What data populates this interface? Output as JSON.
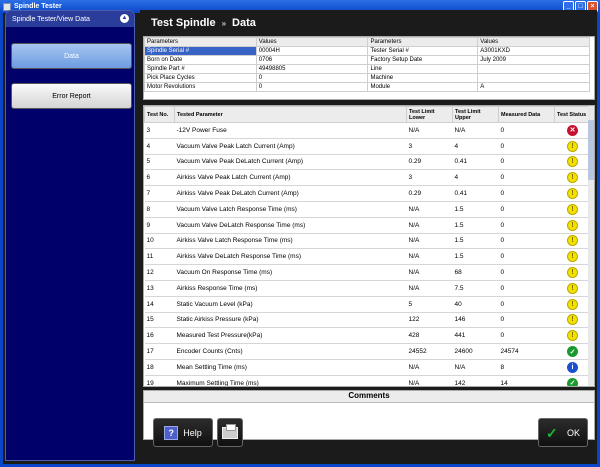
{
  "window": {
    "title": "Spindle Tester"
  },
  "sidebar": {
    "title": "Spindle Tester/View Data",
    "buttons": [
      {
        "label": "Data"
      },
      {
        "label": "Error Report"
      }
    ]
  },
  "header": {
    "crumb1": "Test Spindle",
    "separator": "»",
    "crumb2": "Data"
  },
  "params": {
    "headers": [
      "Parameters",
      "Values",
      "Parameters",
      "Values"
    ],
    "rows": [
      [
        "Spindle Serial #",
        "00004H",
        "Tester Serial #",
        "A3001KXD"
      ],
      [
        "Born on Date",
        "0706",
        "Factory Setup Date",
        "July 2009"
      ],
      [
        "Spindle Part #",
        "49498805",
        "Line",
        ""
      ],
      [
        "Pick Place Cycles",
        "0",
        "Machine",
        ""
      ],
      [
        "Motor Revolutions",
        "0",
        "Module",
        "A"
      ]
    ]
  },
  "tests": {
    "headers": [
      "Test No.",
      "Tested Parameter",
      "Test Limit Lower",
      "Test Limit Upper",
      "Measured Data",
      "Test Status"
    ],
    "rows": [
      {
        "no": "3",
        "param": "-12V Power Fuse",
        "lower": "N/A",
        "upper": "N/A",
        "measured": "0",
        "status": "fail"
      },
      {
        "no": "4",
        "param": "Vacuum Valve Peak Latch Current (Amp)",
        "lower": "3",
        "upper": "4",
        "measured": "0",
        "status": "warn"
      },
      {
        "no": "5",
        "param": "Vacuum Valve Peak DeLatch Current (Amp)",
        "lower": "0.29",
        "upper": "0.41",
        "measured": "0",
        "status": "warn"
      },
      {
        "no": "6",
        "param": "Airkiss Valve Peak Latch Current (Amp)",
        "lower": "3",
        "upper": "4",
        "measured": "0",
        "status": "warn"
      },
      {
        "no": "7",
        "param": "Airkiss Valve Peak DeLatch Current (Amp)",
        "lower": "0.29",
        "upper": "0.41",
        "measured": "0",
        "status": "warn"
      },
      {
        "no": "8",
        "param": "Vacuum Valve Latch Response Time (ms)",
        "lower": "N/A",
        "upper": "1.5",
        "measured": "0",
        "status": "warn"
      },
      {
        "no": "9",
        "param": "Vacuum Valve DeLatch Response Time (ms)",
        "lower": "N/A",
        "upper": "1.5",
        "measured": "0",
        "status": "warn"
      },
      {
        "no": "10",
        "param": "Airkiss Valve Latch Response Time (ms)",
        "lower": "N/A",
        "upper": "1.5",
        "measured": "0",
        "status": "warn"
      },
      {
        "no": "11",
        "param": "Airkiss Valve DeLatch Response Time (ms)",
        "lower": "N/A",
        "upper": "1.5",
        "measured": "0",
        "status": "warn"
      },
      {
        "no": "12",
        "param": "Vacuum On Response Time (ms)",
        "lower": "N/A",
        "upper": "68",
        "measured": "0",
        "status": "warn"
      },
      {
        "no": "13",
        "param": "Airkiss Response Time (ms)",
        "lower": "N/A",
        "upper": "7.5",
        "measured": "0",
        "status": "warn"
      },
      {
        "no": "14",
        "param": "Static Vacuum Level (kPa)",
        "lower": "5",
        "upper": "40",
        "measured": "0",
        "status": "warn"
      },
      {
        "no": "15",
        "param": "Static Airkiss Pressure (kPa)",
        "lower": "122",
        "upper": "146",
        "measured": "0",
        "status": "warn"
      },
      {
        "no": "16",
        "param": "Measured Test Pressure(kPa)",
        "lower": "428",
        "upper": "441",
        "measured": "0",
        "status": "warn"
      },
      {
        "no": "17",
        "param": "Encoder Counts (Cnts)",
        "lower": "24552",
        "upper": "24600",
        "measured": "24574",
        "status": "pass"
      },
      {
        "no": "18",
        "param": "Mean Settling Time (ms)",
        "lower": "N/A",
        "upper": "N/A",
        "measured": "8",
        "status": "info"
      },
      {
        "no": "19",
        "param": "Maximum Settling Time (ms)",
        "lower": "N/A",
        "upper": "142",
        "measured": "14",
        "status": "pass"
      }
    ]
  },
  "comments": {
    "title": "Comments",
    "text": ""
  },
  "footer": {
    "help_label": "Help",
    "ok_label": "OK"
  },
  "icons": {
    "fail": "x-circle-icon",
    "warn": "exclamation-icon",
    "pass": "check-circle-icon",
    "info": "info-icon"
  }
}
